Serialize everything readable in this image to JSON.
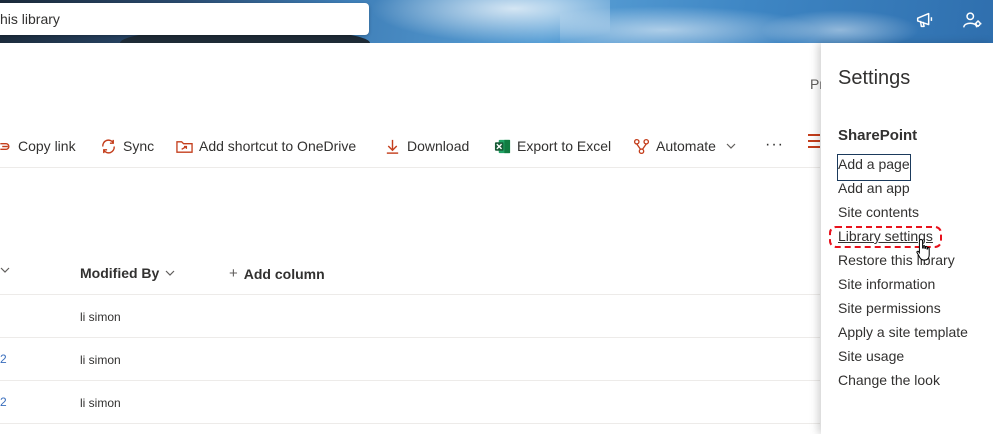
{
  "header": {
    "search_placeholder": "his library"
  },
  "toolbar_truncated": "Pr",
  "commands": {
    "copy_link": "Copy link",
    "sync": "Sync",
    "add_shortcut": "Add shortcut to OneDrive",
    "download": "Download",
    "export_excel": "Export to Excel",
    "automate": "Automate",
    "more": "···"
  },
  "table": {
    "columns": {
      "modified_by": "Modified By",
      "add_column": "Add column"
    },
    "rows": [
      {
        "left": "",
        "modified_by": "li simon"
      },
      {
        "left": "2",
        "modified_by": "li simon"
      },
      {
        "left": "2",
        "modified_by": "li simon"
      }
    ]
  },
  "settings": {
    "title": "Settings",
    "section": "SharePoint",
    "links": [
      "Add a page",
      "Add an app",
      "Site contents",
      "Library settings",
      "Restore this library",
      "Site information",
      "Site permissions",
      "Apply a site template",
      "Site usage",
      "Change the look"
    ]
  },
  "colors": {
    "accent_red": "#e8111c",
    "excel_green": "#1d6f42",
    "download_orange": "#c43e1c"
  }
}
